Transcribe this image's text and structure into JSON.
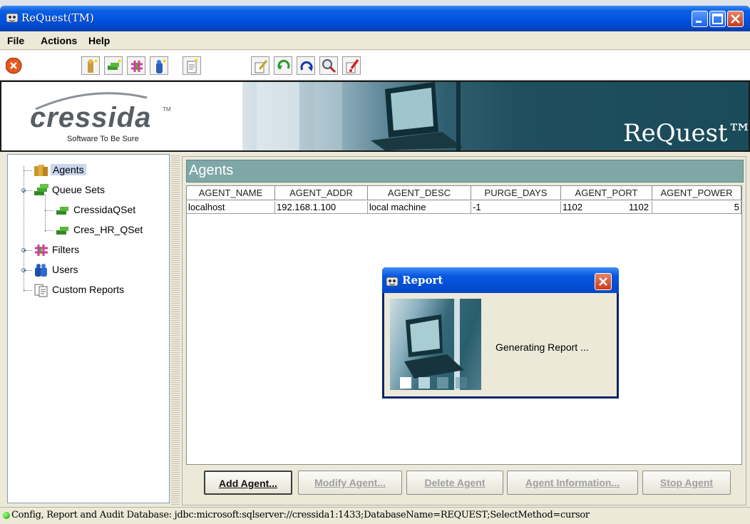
{
  "window": {
    "title": "ReQuest(TM)"
  },
  "menu": {
    "file": "File",
    "actions": "Actions",
    "help": "Help"
  },
  "banner": {
    "logo_word": "cressida",
    "logo_tm": "TM",
    "logo_tagline": "Software To Be Sure",
    "brand": "ReQuest™"
  },
  "toolbar": {
    "icons": [
      "stop-icon",
      "add-agent-icon",
      "add-queue-set-icon",
      "add-filter-icon",
      "add-user-icon",
      "add-report-icon",
      "edit-icon",
      "undo-icon",
      "refresh-icon",
      "search-icon",
      "delete-icon"
    ]
  },
  "tree": {
    "agents": "Agents",
    "queue_sets": "Queue Sets",
    "qset1": "CressidaQSet",
    "qset2": "Cres_HR_QSet",
    "filters": "Filters",
    "users": "Users",
    "custom_reports": "Custom Reports"
  },
  "panel": {
    "title": "Agents",
    "columns": [
      "AGENT_NAME",
      "AGENT_ADDR",
      "AGENT_DESC",
      "PURGE_DAYS",
      "AGENT_PORT",
      "AGENT_POWER"
    ],
    "row": {
      "name": "localhost",
      "addr": "192.168.1.100",
      "desc": "local machine",
      "purge": "-1",
      "port_a": "1102",
      "port_b": "1102",
      "power": "5"
    }
  },
  "buttons": {
    "add": "Add Agent...",
    "modify": "Modify Agent...",
    "delete": "Delete Agent",
    "info": "Agent Information...",
    "stop": "Stop Agent"
  },
  "dialog": {
    "title": "Report",
    "message": "Generating Report ..."
  },
  "status": {
    "text": "Config, Report and Audit Database: jdbc:microsoft:sqlserver://cressida1:1433;DatabaseName=REQUEST;SelectMethod=cursor"
  },
  "colors": {
    "title_blue": "#0054e3",
    "panel_header": "#7fa7a7",
    "status_green": "#10a010"
  }
}
